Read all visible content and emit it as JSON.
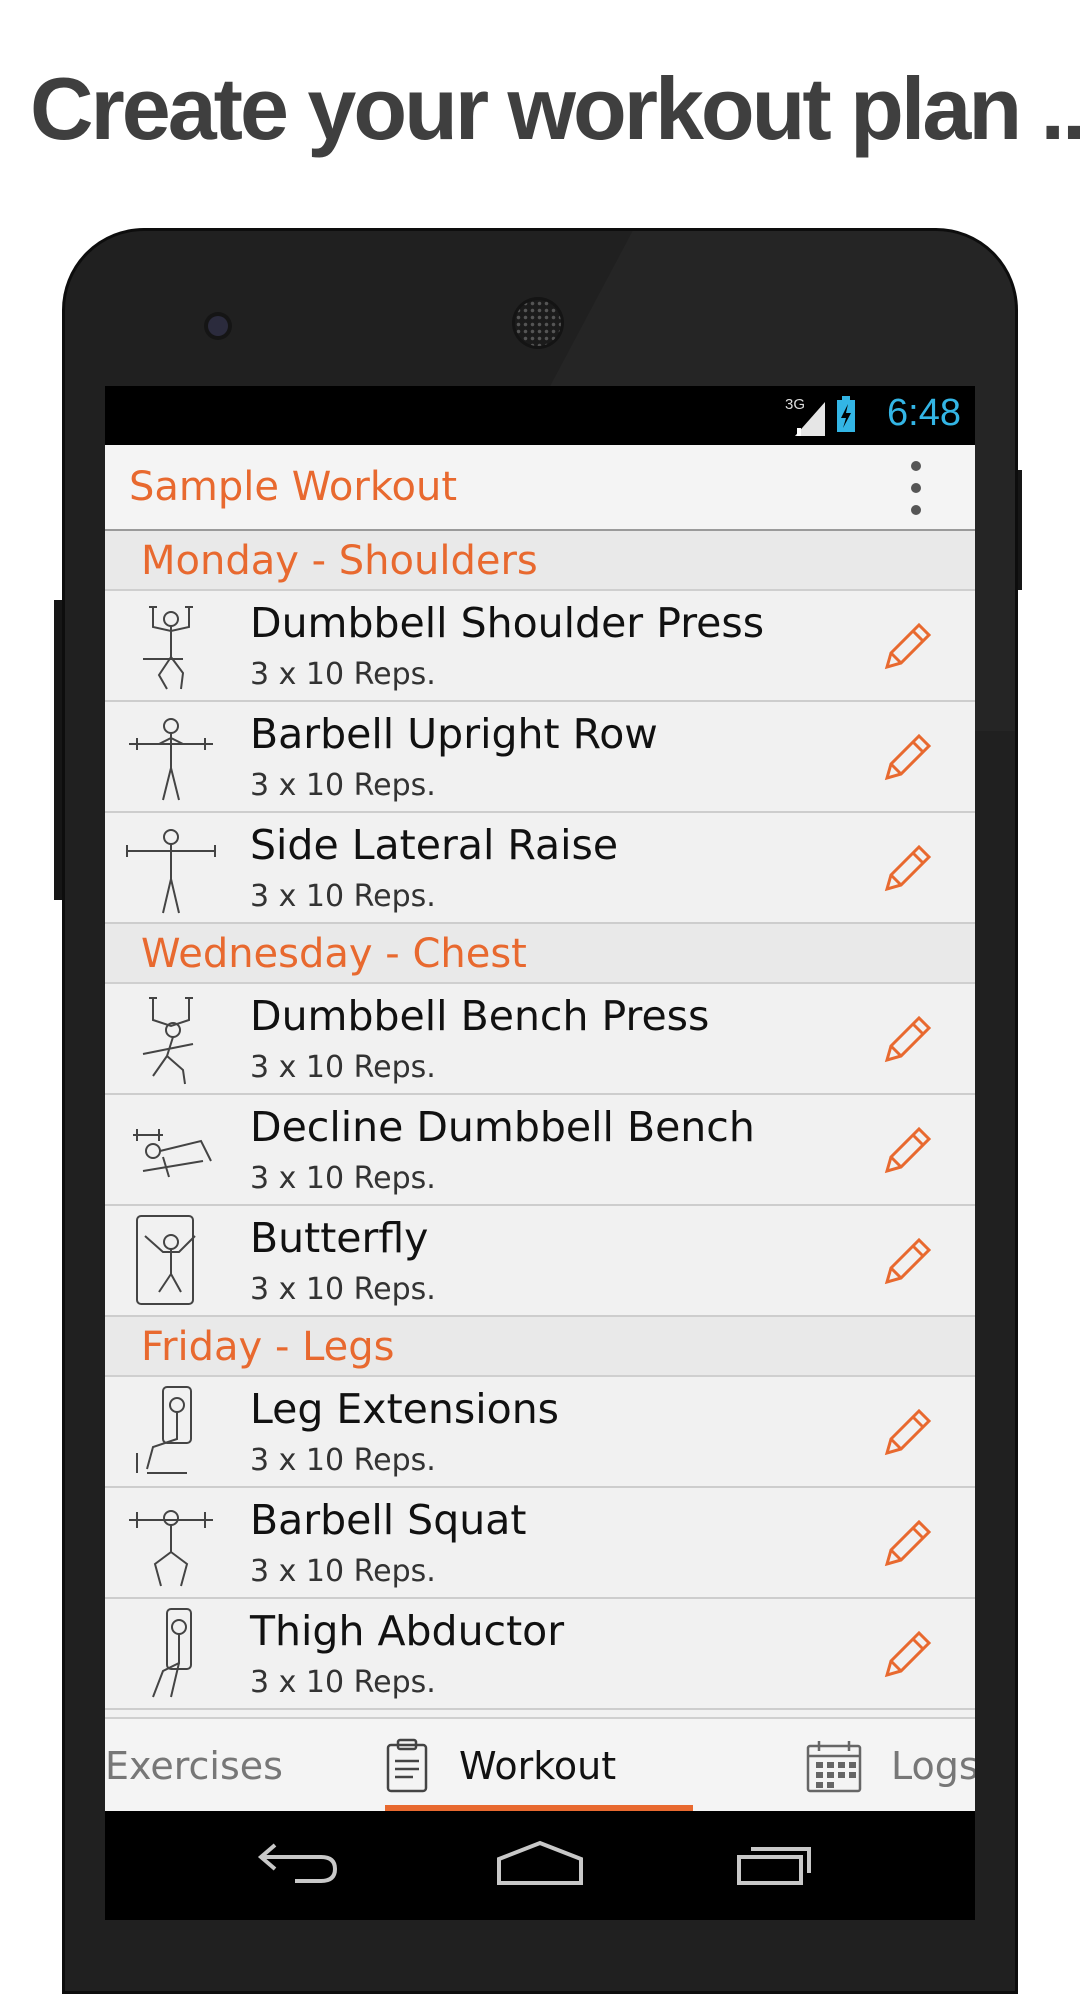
{
  "headline": "Create your workout plan ...",
  "status_bar": {
    "network": "3G",
    "time": "6:48",
    "time_color": "#33b5e5"
  },
  "action_bar": {
    "title": "Sample Workout",
    "overflow_icon": "overflow-menu-icon"
  },
  "accent_color": "#e8692f",
  "sections": [
    {
      "title": "Monday - Shoulders",
      "exercises": [
        {
          "name": "Dumbbell Shoulder Press",
          "detail": "3 x 10 Reps."
        },
        {
          "name": "Barbell Upright Row",
          "detail": "3 x 10 Reps."
        },
        {
          "name": "Side Lateral Raise",
          "detail": "3 x 10 Reps."
        }
      ]
    },
    {
      "title": "Wednesday - Chest",
      "exercises": [
        {
          "name": "Dumbbell Bench Press",
          "detail": "3 x 10 Reps."
        },
        {
          "name": "Decline Dumbbell Bench",
          "detail": "3 x 10 Reps."
        },
        {
          "name": "Butterfly",
          "detail": "3 x 10 Reps."
        }
      ]
    },
    {
      "title": "Friday - Legs",
      "exercises": [
        {
          "name": "Leg Extensions",
          "detail": "3 x 10 Reps."
        },
        {
          "name": "Barbell Squat",
          "detail": "3 x 10 Reps."
        },
        {
          "name": "Thigh Abductor",
          "detail": "3 x 10 Reps."
        }
      ]
    }
  ],
  "tabs": [
    {
      "label": "Exercises",
      "icon": null,
      "selected": false
    },
    {
      "label": "Workout",
      "icon": "clipboard-icon",
      "selected": true
    },
    {
      "label": "Logs",
      "icon": "calendar-icon",
      "selected": false
    }
  ],
  "nav_bar": [
    "back-icon",
    "home-icon",
    "recent-apps-icon"
  ]
}
